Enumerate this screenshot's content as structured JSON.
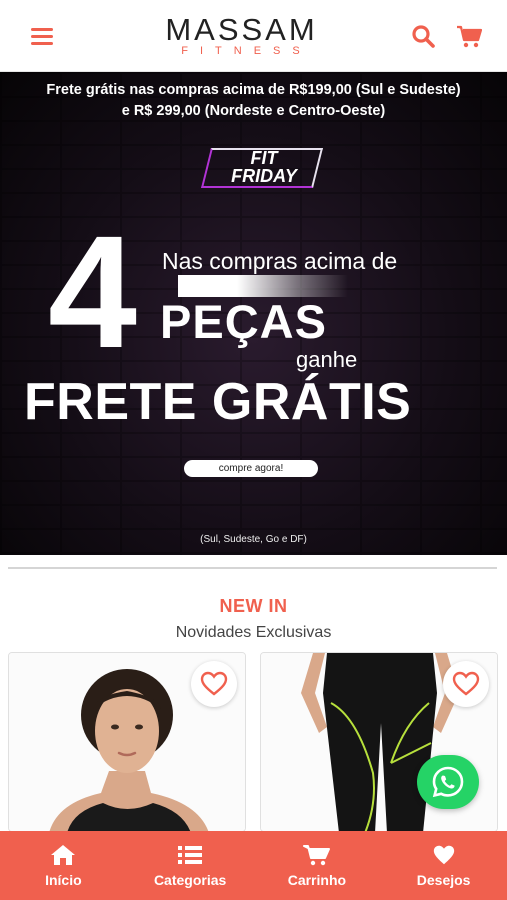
{
  "header": {
    "brand": "MASSAM",
    "brand_sub": "FITNESS"
  },
  "banner": {
    "shipping_line1": "Frete grátis nas compras acima de R$199,00 (Sul e Sudeste)",
    "shipping_line2": "e R$ 299,00 (Nordeste e Centro-Oeste)",
    "badge_line1": "FIT",
    "badge_line2": "FRIDAY",
    "number": "4",
    "text_line1": "Nas compras acima de",
    "text_line2": "PEÇAS",
    "text_line3": "ganhe",
    "text_line4": "FRETE GRÁTIS",
    "cta_label": "compre agora!",
    "region_note": "(Sul, Sudeste, Go e DF)"
  },
  "section": {
    "title": "NEW IN",
    "subtitle": "Novidades Exclusivas"
  },
  "colors": {
    "accent": "#f0604e",
    "whatsapp": "#25d366",
    "badge_purple": "#b233d6"
  },
  "bottom_nav": {
    "items": [
      {
        "label": "Início",
        "icon": "home-icon"
      },
      {
        "label": "Categorias",
        "icon": "list-icon"
      },
      {
        "label": "Carrinho",
        "icon": "cart-icon"
      },
      {
        "label": "Desejos",
        "icon": "heart-icon"
      }
    ]
  }
}
